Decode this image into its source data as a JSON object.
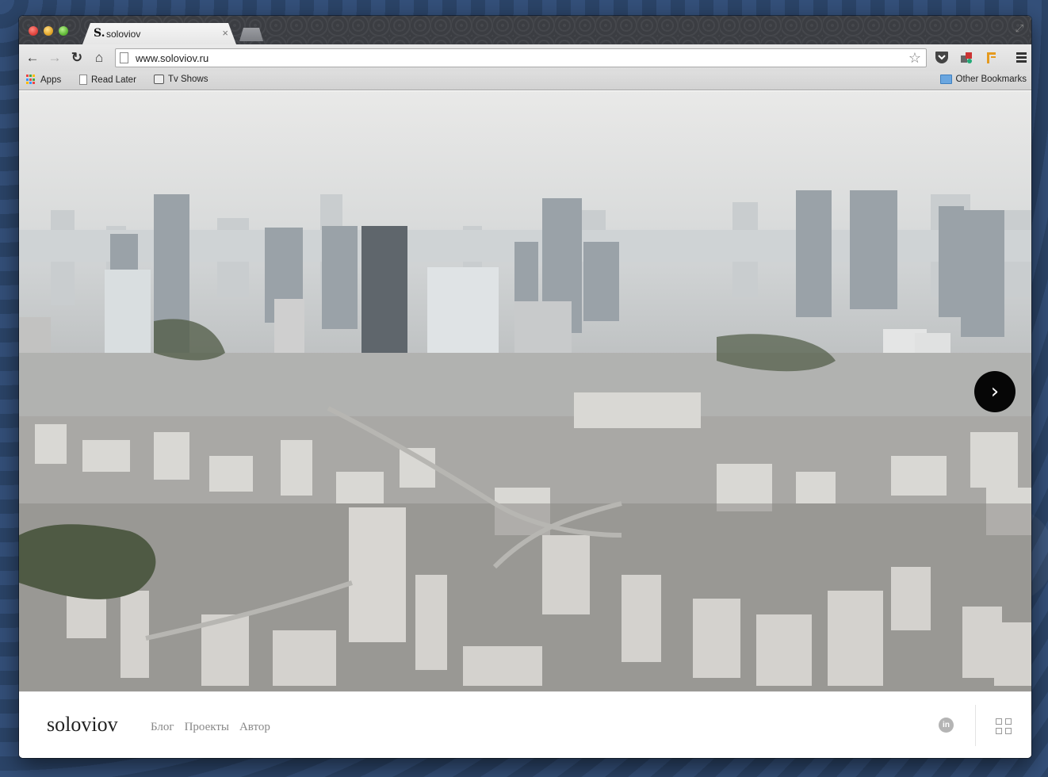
{
  "browser": {
    "tab": {
      "favicon": "S.",
      "title": "soloviov"
    },
    "url": "www.soloviov.ru",
    "icons": {
      "back": "back-arrow-icon",
      "forward": "forward-arrow-icon",
      "reload": "reload-icon",
      "home": "home-icon",
      "star": "star-icon",
      "menu": "hamburger-menu-icon"
    },
    "glyphs": {
      "back": "←",
      "forward": "→",
      "reload": "↻",
      "home": "⌂",
      "star": "☆",
      "close": "×",
      "fullscreen": "⤢"
    },
    "bookmarks": [
      {
        "label": "Apps",
        "icon": "apps-grid-icon"
      },
      {
        "label": "Read Later",
        "icon": "page-icon"
      },
      {
        "label": "Tv Shows",
        "icon": "tv-icon"
      }
    ],
    "other_bookmarks": "Other Bookmarks"
  },
  "site": {
    "logo": "soloviov",
    "nav": [
      "Блог",
      "Проекты",
      "Автор"
    ],
    "linkedin_glyph": "in",
    "next_glyph": "›"
  },
  "colors": {
    "next_button": "#060606",
    "nav_text": "#888888",
    "desktop": "#2f4a6d"
  }
}
